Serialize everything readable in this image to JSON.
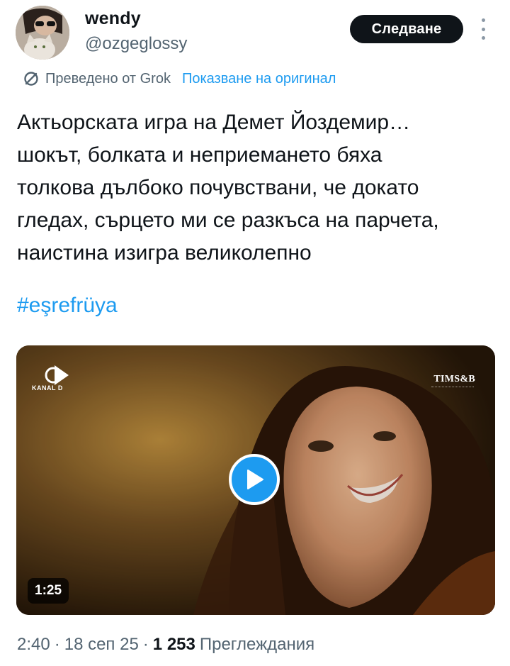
{
  "author": {
    "display_name": "wendy",
    "username": "@ozgeglossy",
    "avatar_icon": "profile-photo"
  },
  "header": {
    "follow_label": "Следване",
    "more_icon": "more-vertical-icon"
  },
  "translation": {
    "label": "Преведено от Grok",
    "show_original_label": "Показване на оригинал"
  },
  "tweet": {
    "text": " Актьорската игра на Демет Йоздемир…\nшокът, болката и неприемането бяха\nтолкова дълбоко почувствани, че докато\nгледах, сърцето ми се разкъса на парчета,\nнаистина изигра великолепно",
    "hashtag": "#eşrefrüya"
  },
  "video": {
    "channel_logo": "KANAL D",
    "producer_logo": "TIMS&B",
    "duration": "1:25",
    "play_icon": "play-icon"
  },
  "meta": {
    "time": "2:40",
    "date": "18 сеп 25",
    "views_count": "1 253",
    "views_label": "Преглеждания",
    "separator": "·"
  },
  "colors": {
    "accent": "#1d9bf0",
    "text": "#0f1419",
    "secondary": "#536471"
  }
}
